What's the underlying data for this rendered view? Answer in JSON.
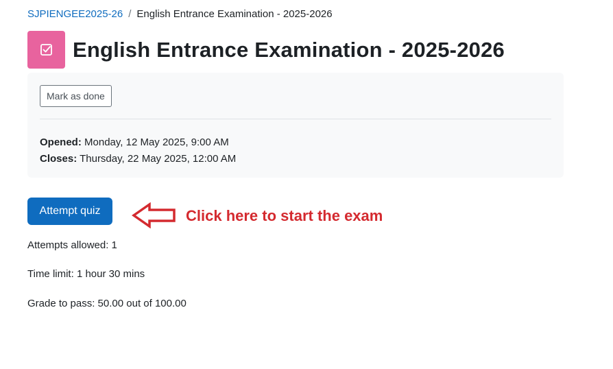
{
  "breadcrumb": {
    "course": "SJPIENGEE2025-26",
    "separator": "/",
    "current": "English Entrance Examination - 2025-2026"
  },
  "header": {
    "title": "English Entrance Examination - 2025-2026",
    "icon": "quiz-checkbox-icon",
    "icon_color": "#e8639e"
  },
  "completion": {
    "mark_as_done_label": "Mark as done"
  },
  "dates": {
    "opened_label": "Opened:",
    "opened_value": "Monday, 12 May 2025, 9:00 AM",
    "closes_label": "Closes:",
    "closes_value": "Thursday, 22 May 2025, 12:00 AM"
  },
  "quiz": {
    "attempt_button_label": "Attempt quiz",
    "button_color": "#0f6cbf",
    "attempts_allowed": "Attempts allowed: 1",
    "time_limit": "Time limit: 1 hour 30 mins",
    "grade_to_pass": "Grade to pass: 50.00 out of 100.00"
  },
  "annotation": {
    "text": "Click here to start the exam",
    "color": "#d42a2f",
    "icon": "left-arrow-icon"
  }
}
